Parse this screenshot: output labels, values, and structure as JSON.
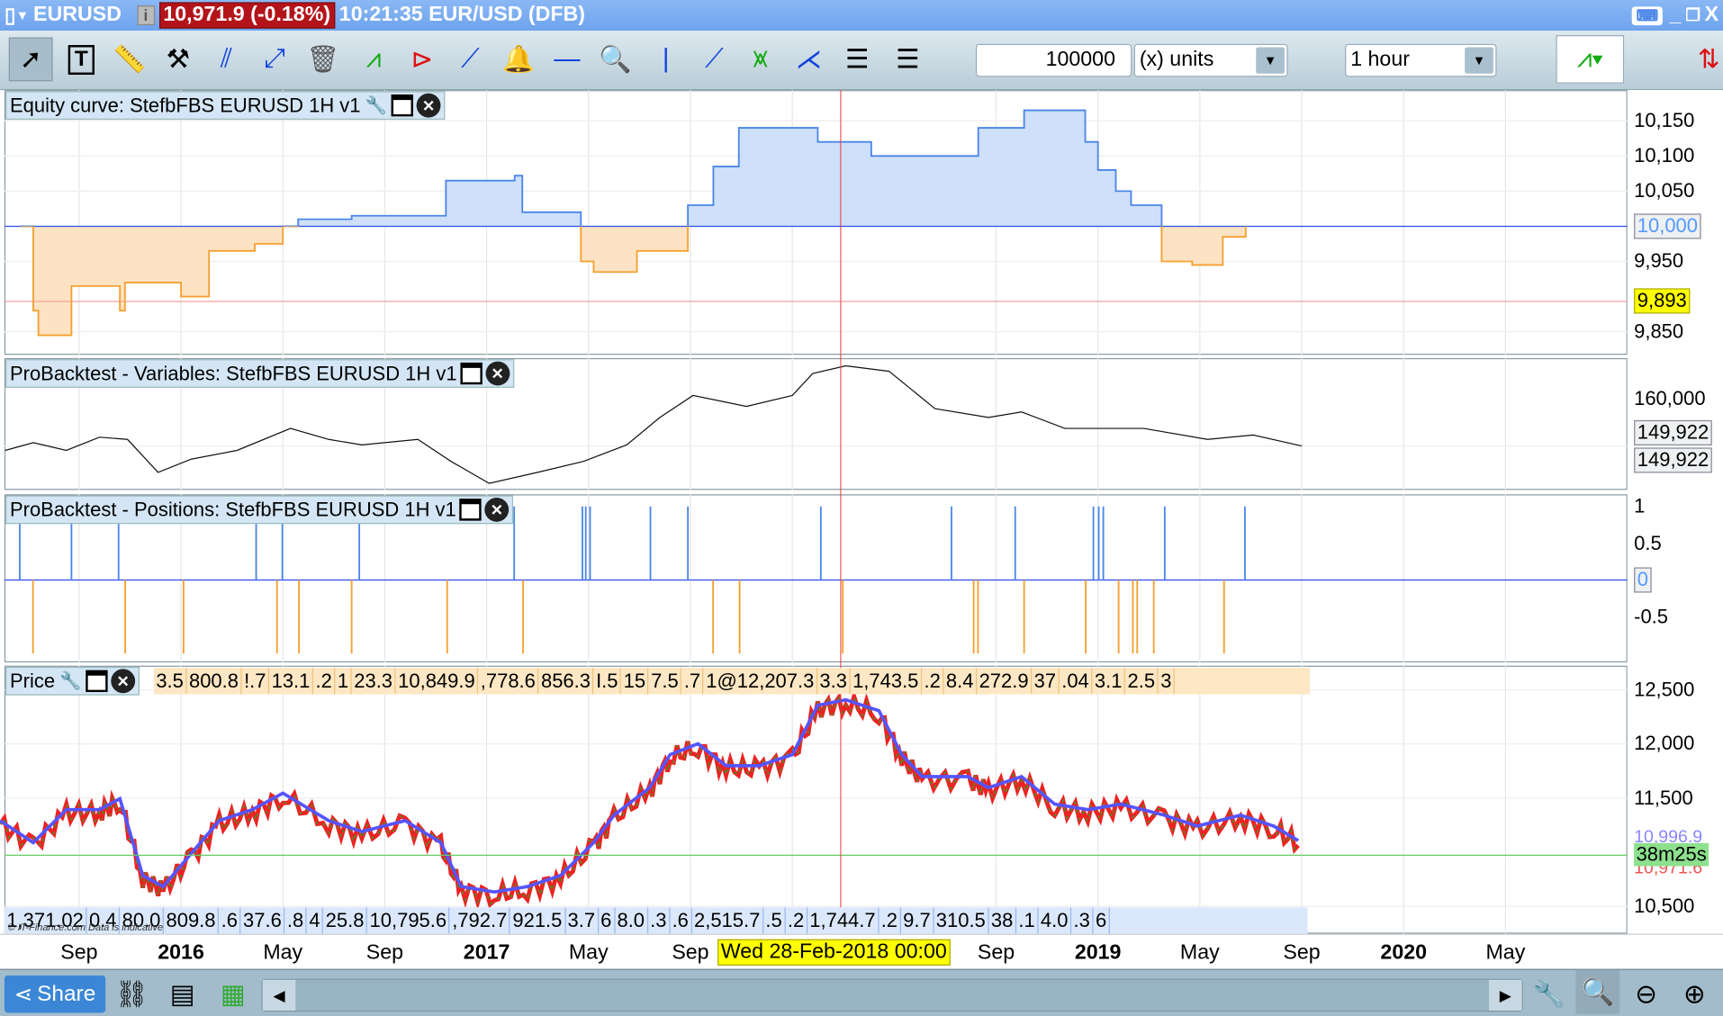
{
  "title_bar": {
    "symbol": "EURUSD",
    "price_badge": "10,971.9 (-0.18%)",
    "time_info": "10:21:35 EUR/USD (DFB)"
  },
  "toolbar": {
    "quantity": "100000",
    "units": "(x) units",
    "timeframe": "1 hour"
  },
  "panels": {
    "equity": {
      "title": "Equity curve: StefbFBS EURUSD 1H v1",
      "axis": [
        "10,150",
        "10,100",
        "10,050",
        "9,950",
        "9,850"
      ],
      "current": "10,000",
      "marker": "9,893"
    },
    "variables": {
      "title": "ProBacktest - Variables: StefbFBS EURUSD 1H v1",
      "axis": "160,000",
      "value1": "149,922",
      "value2": "149,922"
    },
    "positions": {
      "title": "ProBacktest - Positions: StefbFBS EURUSD 1H v1",
      "axis": [
        "1",
        "0.5",
        "-0.5"
      ],
      "zero": "0"
    },
    "price": {
      "title": "Price",
      "axis": [
        "12,500",
        "12,000",
        "11,500",
        "10,500"
      ],
      "countdown": "38m25s",
      "price_a": "10,996.9",
      "price_b": "10,971.6",
      "labels_top": [
        "3.5",
        "800.8",
        "!.7",
        "13.1",
        ".2",
        "1",
        "23.3",
        "10,849.9",
        ",778.6",
        "856.3",
        "I.5",
        "15",
        "7.5",
        ".7",
        "1@12,207.3",
        "3.3",
        "1,743.5",
        ".2",
        "8.4",
        "272.9",
        "37",
        ".04",
        "3.1",
        "2.5",
        "3"
      ],
      "labels_bottom": [
        "1,371.02",
        "0.4",
        "80.0",
        "809.8",
        ".6",
        "37.6",
        ".8",
        "4",
        "25.8",
        "10,795.6",
        ",792.7",
        "921.5",
        "3.7",
        "6",
        "8.0",
        ".3",
        ".6",
        "2,515.7",
        ".5",
        ".2",
        "1,744.7",
        ".2",
        "9.7",
        "310.5",
        "38",
        ".1",
        "4.0",
        ".3",
        "6"
      ],
      "copyright": "© IT-Finance.com Data is indicative"
    }
  },
  "x_axis": {
    "ticks": [
      {
        "label": "Sep",
        "month": 8
      },
      {
        "label": "2016",
        "month": 12,
        "bold": true
      },
      {
        "label": "May",
        "month": 16
      },
      {
        "label": "Sep",
        "month": 20
      },
      {
        "label": "2017",
        "month": 24,
        "bold": true
      },
      {
        "label": "May",
        "month": 28
      },
      {
        "label": "Sep",
        "month": 32
      },
      {
        "label": "Sep",
        "month": 44
      },
      {
        "label": "2019",
        "month": 48,
        "bold": true
      },
      {
        "label": "May",
        "month": 52
      },
      {
        "label": "Sep",
        "month": 56
      },
      {
        "label": "2020",
        "month": 60,
        "bold": true
      },
      {
        "label": "May",
        "month": 64
      }
    ],
    "crosshair_label": "Wed 28-Feb-2018 00:00"
  },
  "bottom_bar": {
    "share": "Share"
  },
  "colors": {
    "equity_up": "#4a86e8",
    "equity_down": "#f5a030",
    "fill_up": "#cfe0fa",
    "fill_down": "#fde3c3",
    "crosshair": "#e33"
  },
  "chart_data": [
    {
      "type": "line",
      "title": "Equity curve",
      "x_unit": "months since Jan 2015",
      "ylim": [
        9830,
        10180
      ],
      "baseline": 10000,
      "points": [
        [
          5.7,
          10000
        ],
        [
          6.2,
          9880
        ],
        [
          6.4,
          9845
        ],
        [
          7.7,
          9915
        ],
        [
          9.6,
          9880
        ],
        [
          9.8,
          9920
        ],
        [
          12.0,
          9900
        ],
        [
          13.1,
          9965
        ],
        [
          14.9,
          9975
        ],
        [
          16.0,
          10000
        ],
        [
          16.6,
          10010
        ],
        [
          18.7,
          10015
        ],
        [
          22.4,
          10065
        ],
        [
          25.1,
          10072
        ],
        [
          25.4,
          10020
        ],
        [
          27.7,
          9950
        ],
        [
          28.2,
          9935
        ],
        [
          29.9,
          9965
        ],
        [
          31.9,
          10030
        ],
        [
          32.9,
          10085
        ],
        [
          33.9,
          10140
        ],
        [
          37.0,
          10120
        ],
        [
          39.1,
          10100
        ],
        [
          43.3,
          10140
        ],
        [
          45.1,
          10165
        ],
        [
          47.5,
          10120
        ],
        [
          48.0,
          10080
        ],
        [
          48.7,
          10050
        ],
        [
          49.3,
          10030
        ],
        [
          50.5,
          9950
        ],
        [
          51.7,
          9945
        ],
        [
          52.9,
          9985
        ],
        [
          53.8,
          10000
        ]
      ]
    },
    {
      "type": "line",
      "title": "Variables",
      "ylim": [
        140000,
        168000
      ],
      "points": [
        [
          5.1,
          149000
        ],
        [
          6.2,
          150640
        ],
        [
          7.5,
          149000
        ],
        [
          8.8,
          151810
        ],
        [
          9.9,
          151340
        ],
        [
          11.1,
          144320
        ],
        [
          12.4,
          147130
        ],
        [
          14.2,
          149000
        ],
        [
          16.3,
          153680
        ],
        [
          17.8,
          151340
        ],
        [
          19.1,
          150170
        ],
        [
          21.3,
          151340
        ],
        [
          22.6,
          146660
        ],
        [
          24.1,
          141980
        ],
        [
          26.0,
          144320
        ],
        [
          27.8,
          146660
        ],
        [
          29.5,
          150170
        ],
        [
          30.8,
          156020
        ],
        [
          32.1,
          160700
        ],
        [
          34.2,
          158360
        ],
        [
          36.0,
          160700
        ],
        [
          36.8,
          165380
        ],
        [
          38.1,
          167020
        ],
        [
          39.8,
          165850
        ],
        [
          41.6,
          157890
        ],
        [
          43.7,
          156020
        ],
        [
          45.0,
          157190
        ],
        [
          46.7,
          153680
        ],
        [
          49.8,
          153680
        ],
        [
          52.3,
          151340
        ],
        [
          54.1,
          152270
        ],
        [
          56.0,
          149940
        ]
      ]
    },
    {
      "type": "bar",
      "title": "Positions",
      "ylim": [
        -1,
        1
      ],
      "long": [
        5.67,
        7.7,
        9.55,
        14.95,
        15.98,
        19.0,
        25.08,
        27.76,
        27.89,
        28.06,
        30.43,
        31.9,
        37.12,
        42.25,
        44.75,
        47.82,
        48.03,
        48.21,
        50.62,
        53.77
      ],
      "short": [
        6.19,
        9.81,
        12.1,
        15.77,
        16.63,
        18.7,
        22.45,
        25.43,
        32.89,
        33.93,
        37.98,
        43.12,
        43.29,
        45.1,
        47.52,
        48.81,
        49.37,
        49.54,
        50.19,
        52.95
      ]
    },
    {
      "type": "line",
      "title": "Price",
      "ylim": [
        10400,
        12600
      ],
      "current": 10971,
      "points": [
        [
          4.9,
          11261
        ],
        [
          6.2,
          11058
        ],
        [
          7.5,
          11363
        ],
        [
          8.8,
          11363
        ],
        [
          9.6,
          11464
        ],
        [
          10.5,
          10754
        ],
        [
          11.3,
          10652
        ],
        [
          12.4,
          10957
        ],
        [
          13.5,
          11261
        ],
        [
          14.8,
          11363
        ],
        [
          16.0,
          11515
        ],
        [
          17.8,
          11261
        ],
        [
          19.1,
          11160
        ],
        [
          20.8,
          11261
        ],
        [
          22.2,
          11058
        ],
        [
          23.0,
          10652
        ],
        [
          24.3,
          10602
        ],
        [
          25.6,
          10652
        ],
        [
          26.9,
          10754
        ],
        [
          28.2,
          11058
        ],
        [
          29.0,
          11312
        ],
        [
          30.4,
          11566
        ],
        [
          31.2,
          11871
        ],
        [
          32.3,
          11972
        ],
        [
          33.4,
          11769
        ],
        [
          34.7,
          11769
        ],
        [
          36.0,
          11871
        ],
        [
          37.0,
          12327
        ],
        [
          38.1,
          12378
        ],
        [
          39.4,
          12277
        ],
        [
          40.3,
          11871
        ],
        [
          41.1,
          11668
        ],
        [
          42.9,
          11668
        ],
        [
          43.7,
          11566
        ],
        [
          45.0,
          11668
        ],
        [
          46.3,
          11414
        ],
        [
          47.6,
          11363
        ],
        [
          48.9,
          11414
        ],
        [
          50.6,
          11312
        ],
        [
          51.9,
          11211
        ],
        [
          53.6,
          11312
        ],
        [
          54.9,
          11211
        ],
        [
          56.0,
          11058
        ]
      ]
    }
  ]
}
